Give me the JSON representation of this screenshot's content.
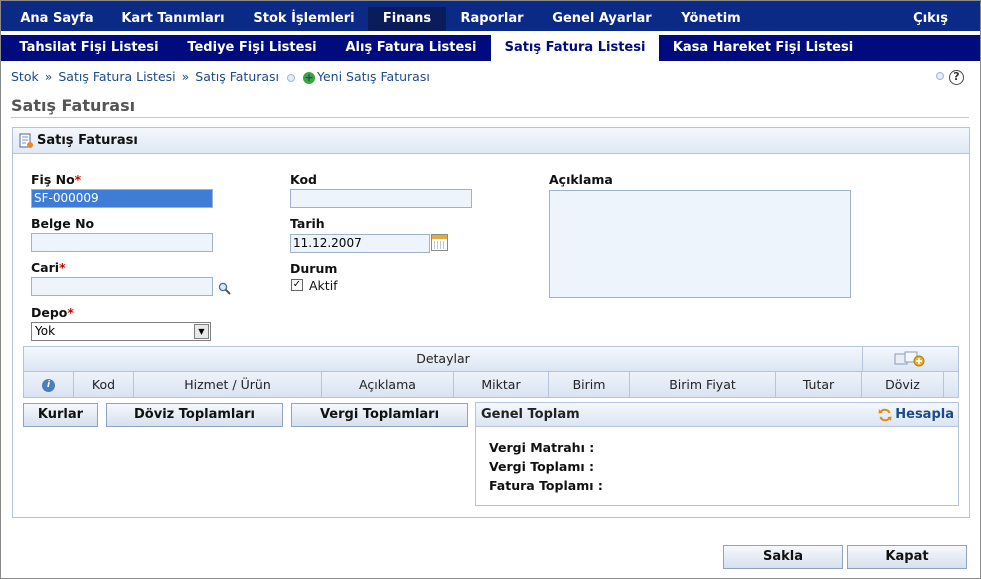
{
  "topnav": {
    "items": [
      "Ana Sayfa",
      "Kart Tanımları",
      "Stok İşlemleri",
      "Finans",
      "Raporlar",
      "Genel Ayarlar",
      "Yönetim"
    ],
    "active": "Finans",
    "exit": "Çıkış"
  },
  "subnav": {
    "items": [
      "Tahsilat Fişi Listesi",
      "Tediye Fişi Listesi",
      "Alış Fatura Listesi",
      "Satış Fatura Listesi",
      "Kasa Hareket Fişi Listesi"
    ],
    "active": "Satış Fatura Listesi"
  },
  "breadcrumb": {
    "items": [
      "Stok",
      "Satış Fatura Listesi",
      "Satış Faturası"
    ],
    "separator": "»",
    "new_link": "Yeni Satış Faturası"
  },
  "help": {
    "label": "?"
  },
  "page": {
    "title": "Satış Faturası"
  },
  "panel": {
    "title": "Satış Faturası",
    "fields": {
      "fis_no": {
        "label": "Fiş No",
        "required_mark": "*",
        "value": "SF-000009"
      },
      "belge_no": {
        "label": "Belge No",
        "value": ""
      },
      "cari": {
        "label": "Cari",
        "required_mark": "*",
        "value": ""
      },
      "depo": {
        "label": "Depo",
        "required_mark": "*",
        "value": "Yok"
      },
      "kod": {
        "label": "Kod",
        "value": ""
      },
      "tarih": {
        "label": "Tarih",
        "value": "11.12.2007"
      },
      "durum": {
        "label": "Durum",
        "checkbox_label": "Aktif",
        "checked": true,
        "check_mark": "✓"
      },
      "aciklama": {
        "label": "Açıklama",
        "value": ""
      }
    }
  },
  "details": {
    "caption": "Detaylar",
    "info_icon": "i",
    "columns": [
      "Kod",
      "Hizmet / Ürün",
      "Açıklama",
      "Miktar",
      "Birim",
      "Birim Fiyat",
      "Tutar",
      "Döviz"
    ]
  },
  "buttons": {
    "kurlar": "Kurlar",
    "doviz_toplamlari": "Döviz Toplamları",
    "vergi_toplamlari": "Vergi Toplamları",
    "save": "Sakla",
    "close": "Kapat"
  },
  "totals": {
    "title": "Genel Toplam",
    "calc_label": "Hesapla",
    "rows": [
      "Vergi Matrahı :",
      "Vergi Toplamı :",
      "Fatura Toplamı :"
    ]
  },
  "colors": {
    "nav": "#0a2a86",
    "subnav": "#000c7e",
    "link": "#1d4a8a",
    "required": "#cc0000"
  }
}
